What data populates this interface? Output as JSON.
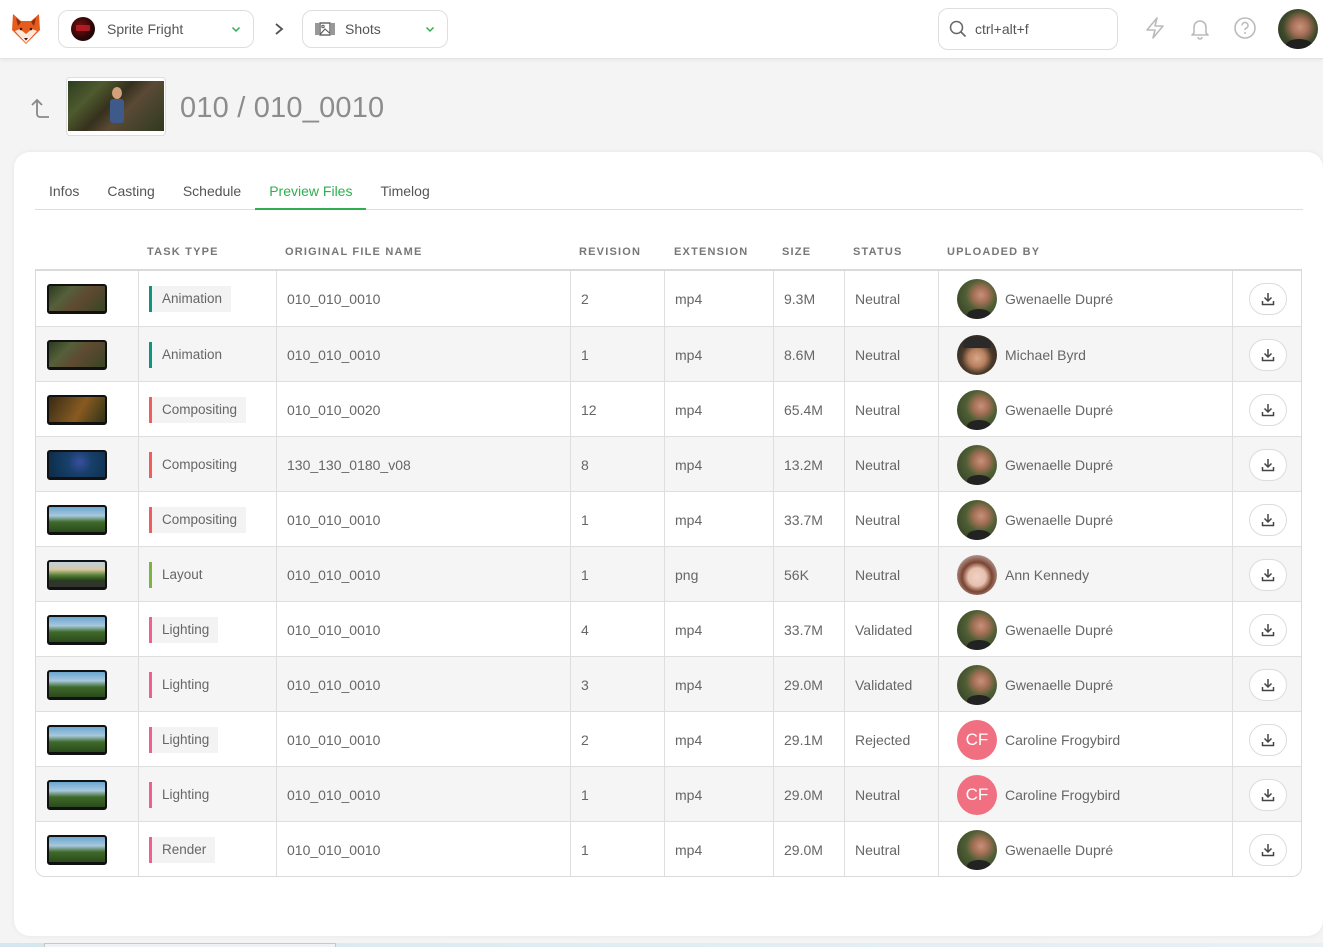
{
  "topbar": {
    "logo": "kitsu-fox-logo",
    "production": {
      "name": "Sprite Fright",
      "icon": "production-avatar"
    },
    "breadcrumb_separator": "chevron-right-icon",
    "section": {
      "name": "Shots",
      "icon": "shots-film-icon"
    },
    "search": {
      "placeholder": "ctrl+alt+f",
      "value": ""
    },
    "icons": [
      "lightning-icon",
      "bell-icon",
      "help-icon"
    ],
    "user_avatar": "current-user-avatar"
  },
  "header": {
    "back_icon": "back-arrow-icon",
    "title": "010 / 010_0010"
  },
  "tabs": [
    {
      "label": "Infos",
      "active": false
    },
    {
      "label": "Casting",
      "active": false
    },
    {
      "label": "Schedule",
      "active": false
    },
    {
      "label": "Preview Files",
      "active": true
    },
    {
      "label": "Timelog",
      "active": false
    }
  ],
  "colors": {
    "accent_green": "#2fae50",
    "animation": "#109482",
    "compositing": "#f25c5c",
    "layout": "#7cb342",
    "lighting": "#ef5f92",
    "render": "#ef5f92",
    "cf_avatar": "#f06f80"
  },
  "table": {
    "columns": [
      "",
      "TASK TYPE",
      "ORIGINAL FILE NAME",
      "REVISION",
      "EXTENSION",
      "SIZE",
      "STATUS",
      "UPLOADED BY",
      ""
    ],
    "rows": [
      {
        "thumb": "forest-character",
        "task_type": "Animation",
        "task_color": "#109482",
        "file_name": "010_010_0010",
        "revision": "2",
        "extension": "mp4",
        "size": "9.3M",
        "status": "Neutral",
        "uploader": "Gwenaelle Dupré",
        "avatar": "gwen"
      },
      {
        "thumb": "forest-character",
        "task_type": "Animation",
        "task_color": "#109482",
        "file_name": "010_010_0010",
        "revision": "1",
        "extension": "mp4",
        "size": "8.6M",
        "status": "Neutral",
        "uploader": "Michael Byrd",
        "avatar": "mich"
      },
      {
        "thumb": "forest-warm",
        "task_type": "Compositing",
        "task_color": "#f25c5c",
        "file_name": "010_010_0020",
        "revision": "12",
        "extension": "mp4",
        "size": "65.4M",
        "status": "Neutral",
        "uploader": "Gwenaelle Dupré",
        "avatar": "gwen"
      },
      {
        "thumb": "night-mushrooms",
        "task_type": "Compositing",
        "task_color": "#f25c5c",
        "file_name": "130_130_0180_v08",
        "revision": "8",
        "extension": "mp4",
        "size": "13.2M",
        "status": "Neutral",
        "uploader": "Gwenaelle Dupré",
        "avatar": "gwen"
      },
      {
        "thumb": "sky-landscape",
        "task_type": "Compositing",
        "task_color": "#f25c5c",
        "file_name": "010_010_0010",
        "revision": "1",
        "extension": "mp4",
        "size": "33.7M",
        "status": "Neutral",
        "uploader": "Gwenaelle Dupré",
        "avatar": "gwen"
      },
      {
        "thumb": "layout-landscape",
        "task_type": "Layout",
        "task_color": "#7cb342",
        "file_name": "010_010_0010",
        "revision": "1",
        "extension": "png",
        "size": "56K",
        "status": "Neutral",
        "uploader": "Ann Kennedy",
        "avatar": "ann"
      },
      {
        "thumb": "sky-landscape",
        "task_type": "Lighting",
        "task_color": "#ef5f92",
        "file_name": "010_010_0010",
        "revision": "4",
        "extension": "mp4",
        "size": "33.7M",
        "status": "Validated",
        "uploader": "Gwenaelle Dupré",
        "avatar": "gwen"
      },
      {
        "thumb": "sky-landscape",
        "task_type": "Lighting",
        "task_color": "#ef5f92",
        "file_name": "010_010_0010",
        "revision": "3",
        "extension": "mp4",
        "size": "29.0M",
        "status": "Validated",
        "uploader": "Gwenaelle Dupré",
        "avatar": "gwen"
      },
      {
        "thumb": "sky-landscape",
        "task_type": "Lighting",
        "task_color": "#ef5f92",
        "file_name": "010_010_0010",
        "revision": "2",
        "extension": "mp4",
        "size": "29.1M",
        "status": "Rejected",
        "uploader": "Caroline Frogybird",
        "avatar": "cf",
        "initials": "CF"
      },
      {
        "thumb": "sky-landscape",
        "task_type": "Lighting",
        "task_color": "#ef5f92",
        "file_name": "010_010_0010",
        "revision": "1",
        "extension": "mp4",
        "size": "29.0M",
        "status": "Neutral",
        "uploader": "Caroline Frogybird",
        "avatar": "cf",
        "initials": "CF"
      },
      {
        "thumb": "sky-landscape",
        "task_type": "Render",
        "task_color": "#ef5f92",
        "file_name": "010_010_0010",
        "revision": "1",
        "extension": "mp4",
        "size": "29.0M",
        "status": "Neutral",
        "uploader": "Gwenaelle Dupré",
        "avatar": "gwen"
      }
    ],
    "row_action_icon": "download-icon"
  }
}
